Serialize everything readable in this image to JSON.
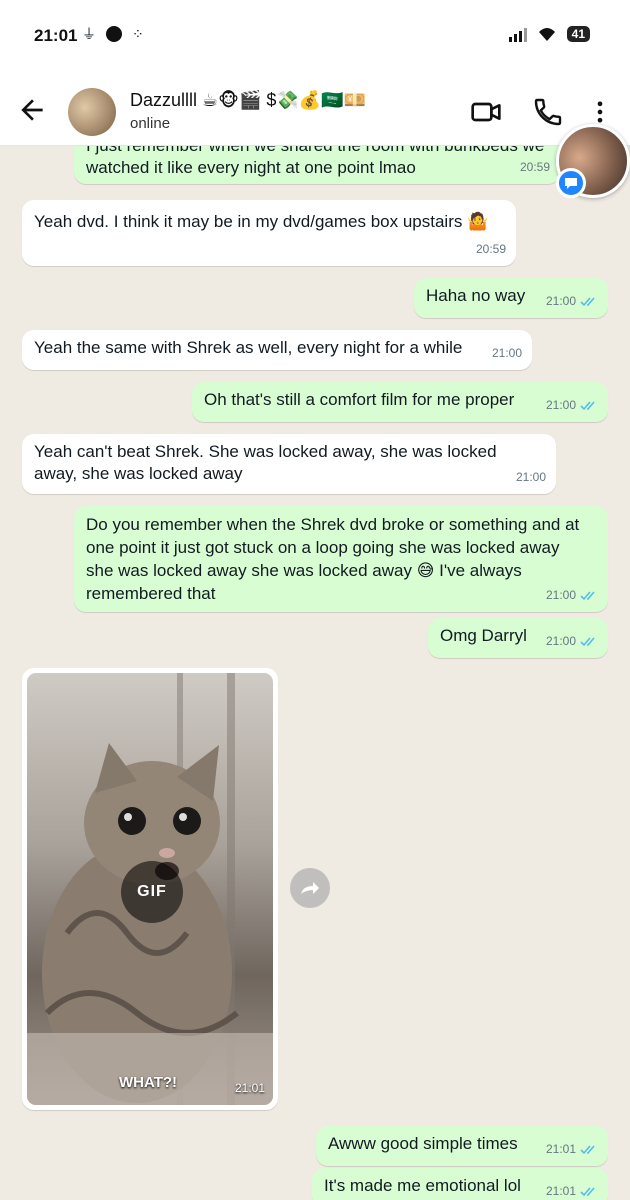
{
  "status_bar": {
    "time": "21:01",
    "battery": "41",
    "icons": [
      "usb-icon",
      "dot-icon",
      "dots-grid-icon",
      "signal-icon",
      "wifi-icon",
      "battery-icon"
    ]
  },
  "header": {
    "contact_name": "Dazzullll ☕🐵🎬 $💸💰🇸🇦💴",
    "contact_status": "online",
    "icons": [
      "back-arrow-icon",
      "avatar",
      "video-call-icon",
      "phone-call-icon",
      "more-vert-icon"
    ]
  },
  "messages": [
    {
      "dir": "out",
      "text": "I just remember when we shared the room with bunkbeds we watched it like every night at one point lmao",
      "time": "20:59"
    },
    {
      "dir": "in",
      "text": "Yeah dvd. I think it may be in my dvd/games box upstairs 🤷",
      "time": "20:59"
    },
    {
      "dir": "out",
      "text": "Haha no way",
      "time": "21:00"
    },
    {
      "dir": "in",
      "text": "Yeah the same with Shrek as well, every night for a while",
      "time": "21:00"
    },
    {
      "dir": "out",
      "text": "Oh that's still a comfort film for me proper",
      "time": "21:00"
    },
    {
      "dir": "in",
      "text": "Yeah can't beat Shrek. She was locked away, she was locked away, she was locked away",
      "time": "21:00"
    },
    {
      "dir": "out",
      "text": "Do you remember when the Shrek dvd broke or something and at one point it just got stuck on a loop going she was locked away she was locked away she was locked away 😅 I've always remembered that",
      "time": "21:00"
    },
    {
      "dir": "out",
      "text": "Omg Darryl",
      "time": "21:00"
    },
    {
      "dir": "in",
      "type": "gif",
      "badge": "GIF",
      "caption": "WHAT?!",
      "time": "21:01"
    },
    {
      "dir": "out",
      "text": "Awww good simple times",
      "time": "21:01"
    },
    {
      "dir": "out",
      "text": "It's made me emotional lol",
      "time": "21:01"
    }
  ],
  "colors": {
    "incoming_bubble": "#ffffff",
    "outgoing_bubble": "#d9fdd3",
    "read_ticks": "#53bdeb",
    "chat_background": "#efeae2"
  }
}
